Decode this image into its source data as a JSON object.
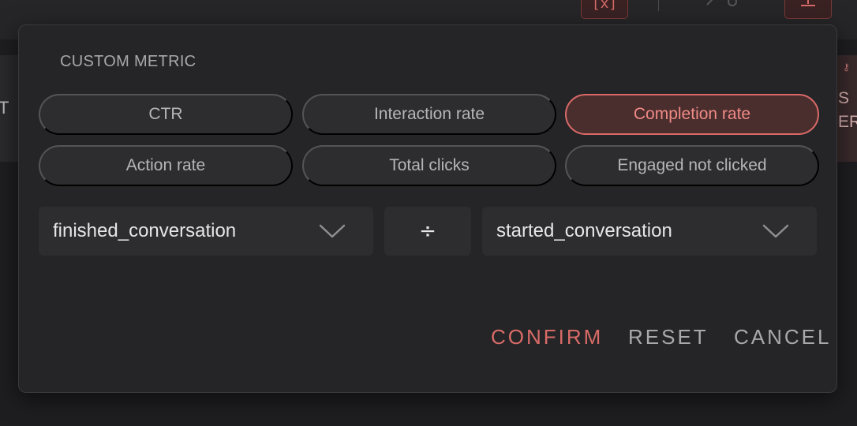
{
  "background": {
    "top_icon_glyph": "[x]",
    "left_letter": "T",
    "right_text_line1": "S",
    "right_text_line2": "ER",
    "right_icon": "key-icon"
  },
  "dialog": {
    "title": "CUSTOM METRIC",
    "chips": [
      {
        "label": "CTR",
        "selected": false
      },
      {
        "label": "Interaction rate",
        "selected": false
      },
      {
        "label": "Completion rate",
        "selected": true
      },
      {
        "label": "Action rate",
        "selected": false
      },
      {
        "label": "Total clicks",
        "selected": false
      },
      {
        "label": "Engaged not clicked",
        "selected": false
      }
    ],
    "numerator": {
      "value": "finished_conversation"
    },
    "operator": "÷",
    "denominator": {
      "value": "started_conversation"
    },
    "actions": {
      "confirm": "CONFIRM",
      "reset": "RESET",
      "cancel": "CANCEL"
    }
  },
  "colors": {
    "accent": "#d96a68",
    "selected_bg": "#4a2e2e",
    "dialog_bg": "#252527",
    "chip_bg": "#2d2d2f"
  }
}
